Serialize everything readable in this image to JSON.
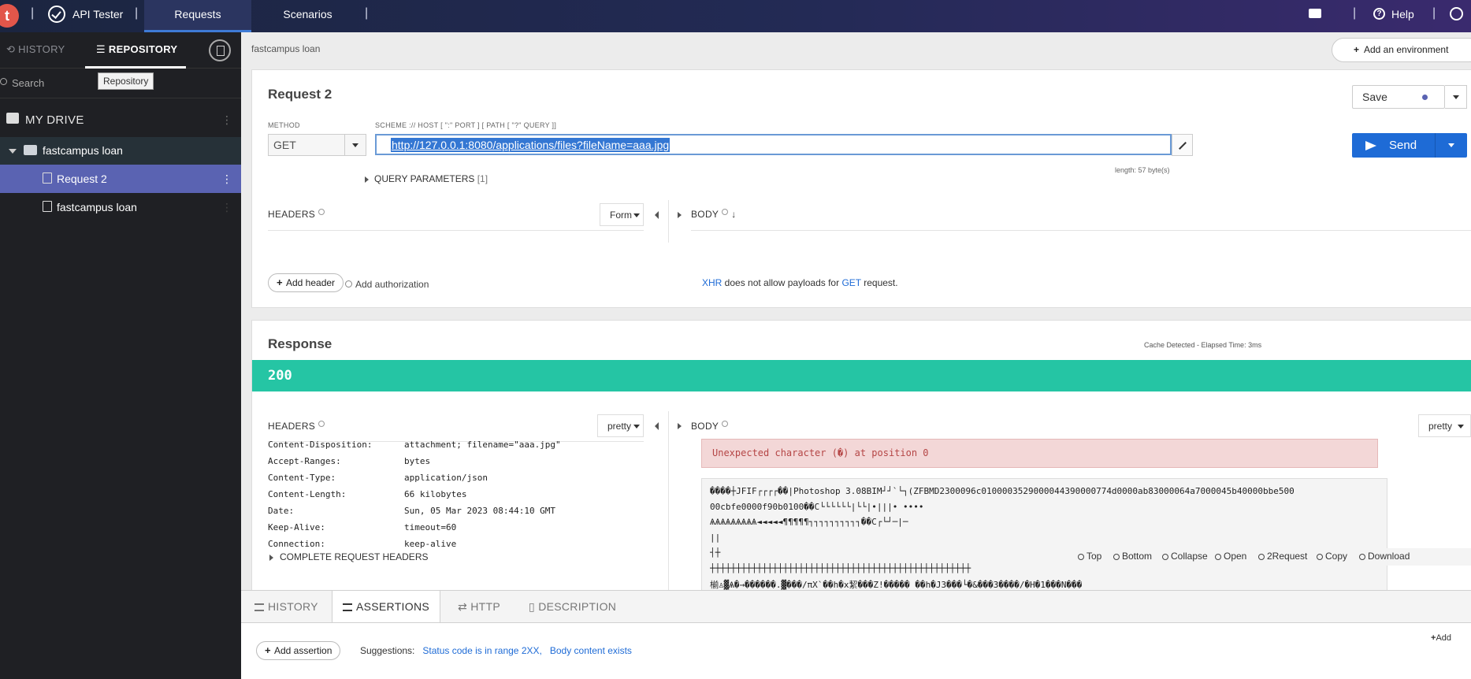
{
  "app": {
    "logo_letter": "t",
    "title": "API Tester",
    "tabs": [
      {
        "label": "Requests",
        "active": true
      },
      {
        "label": "Scenarios",
        "active": false
      }
    ],
    "help_label": "Help"
  },
  "sidebar": {
    "tabs": {
      "history": "HISTORY",
      "repository": "REPOSITORY"
    },
    "search_placeholder": "Search",
    "tooltip": "Repository",
    "drive_label": "MY DRIVE",
    "folder": {
      "label": "fastcampus loan",
      "items": [
        {
          "label": "Request 2",
          "active": true
        },
        {
          "label": "fastcampus loan",
          "active": false
        }
      ]
    }
  },
  "main": {
    "breadcrumb": "fastcampus loan",
    "add_env_label": "Add an environment",
    "request": {
      "title": "Request 2",
      "save_label": "Save",
      "method_label": "METHOD",
      "method_value": "GET",
      "url_label": "SCHEME :// HOST [ \":\" PORT ] [ PATH [ \"?\" QUERY ]]",
      "url_value": "http://127.0.0.1:8080/applications/files?fileName=aaa.jpg",
      "length_note": "length: 57 byte(s)",
      "send_label": "Send",
      "query_params_label": "QUERY PARAMETERS",
      "query_params_count": "[1]",
      "headers_label": "HEADERS",
      "headers_mode": "Form",
      "body_label": "BODY",
      "add_header_label": "Add header",
      "add_authorization_label": "Add authorization",
      "body_note": {
        "xhr": "XHR",
        "middle": " does not allow payloads for ",
        "method": "GET",
        "end": " request."
      }
    },
    "response": {
      "title": "Response",
      "cache_note": "Cache Detected - Elapsed Time: 3ms",
      "status_code": "200",
      "headers_label": "HEADERS",
      "headers_mode": "pretty",
      "body_label": "BODY",
      "body_mode": "pretty",
      "headers": [
        {
          "key": "Content-Disposition:",
          "value": "attachment; filename=\"aaa.jpg\""
        },
        {
          "key": "Accept-Ranges:",
          "value": "bytes"
        },
        {
          "key": "Content-Type:",
          "value": "application/json"
        },
        {
          "key": "Content-Length:",
          "value": "66 kilobytes"
        },
        {
          "key": "Date:",
          "value": "Sun, 05 Mar 2023 08:44:10 GMT"
        },
        {
          "key": "Keep-Alive:",
          "value": "timeout=60"
        },
        {
          "key": "Connection:",
          "value": "keep-alive"
        }
      ],
      "complete_headers_label": "COMPLETE REQUEST HEADERS",
      "error_message": "Unexpected character (�) at position 0",
      "raw_lines": [
        "����┼JFIF┌┌┌┌��|Photoshop 3.08BIM┘┘`└┐(ZFBMD2300096c0100003529000044390000774d0000ab83000064a7000045b40000bbe500",
        "00cbfe0000f90b0100��C└└└└└└|└└|•|||•  ••••",
        "ѦѦѦѦѦѦѦѦѦ◄◄◄◄◄¶¶¶¶¶┐┐┐┐┐┐┐┐┐┐��C┌└┘─|─",
        "||",
        "┤┼",
        "┼┼┼┼┼┼┼┼┼┼┼┼┼┼┼┼┼┼┼┼┼┼┼┼┼┼┼┼┼┼┼┼┼┼┼┼┼┼┼┼┼┼┼┼┼┼┼┼┼┼",
        "椾♙▓Ѧ�→������.▓���/πX`��h�x絜���Z!����� ��h�J3���└�&���3����/�H�1���N���"
      ],
      "raw_toolbar": [
        "Top",
        "Bottom",
        "Collapse",
        "Open",
        "2Request",
        "Copy",
        "Download"
      ]
    }
  },
  "bottom": {
    "tabs": [
      {
        "label": "HISTORY",
        "active": false
      },
      {
        "label": "ASSERTIONS",
        "active": true
      },
      {
        "label": "HTTP",
        "active": false
      },
      {
        "label": "DESCRIPTION",
        "active": false
      }
    ],
    "add_label": "Add",
    "add_assertion_label": "Add assertion",
    "suggestions_label": "Suggestions:",
    "suggestions": [
      "Status code is in range 2XX,",
      "Body content exists"
    ]
  },
  "colors": {
    "accent": "#1e6bd6",
    "status_ok": "#25c5a4",
    "sidebar_active": "#5a63b2",
    "error_bg": "#f3d7d7"
  }
}
